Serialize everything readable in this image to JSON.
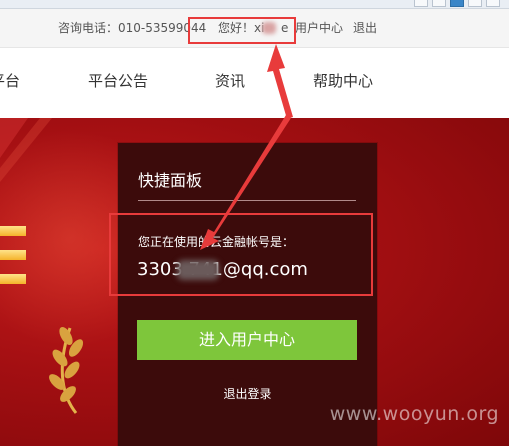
{
  "topbar": {
    "phone_label": "咨询电话：010-53599044",
    "greeting_prefix": "您好！xi",
    "greeting_suffix": "e",
    "user_center": "用户中心",
    "logout": "退出"
  },
  "nav": {
    "items": [
      {
        "label": "平台"
      },
      {
        "label": "平台公告"
      },
      {
        "label": "资讯"
      },
      {
        "label": "帮助中心"
      }
    ]
  },
  "panel": {
    "title": "快捷面板",
    "account_label": "您正在使用的云金融帐号是：",
    "account_value": "3303        741@qq.com",
    "enter_button": "进入用户中心",
    "logout_link": "退出登录"
  },
  "watermark": "www.wooyun.org",
  "colors": {
    "annotation": "#e83b3b",
    "button_green": "#7ec63b",
    "panel_bg": "#3c0b0b",
    "banner_red": "#a30f12"
  }
}
